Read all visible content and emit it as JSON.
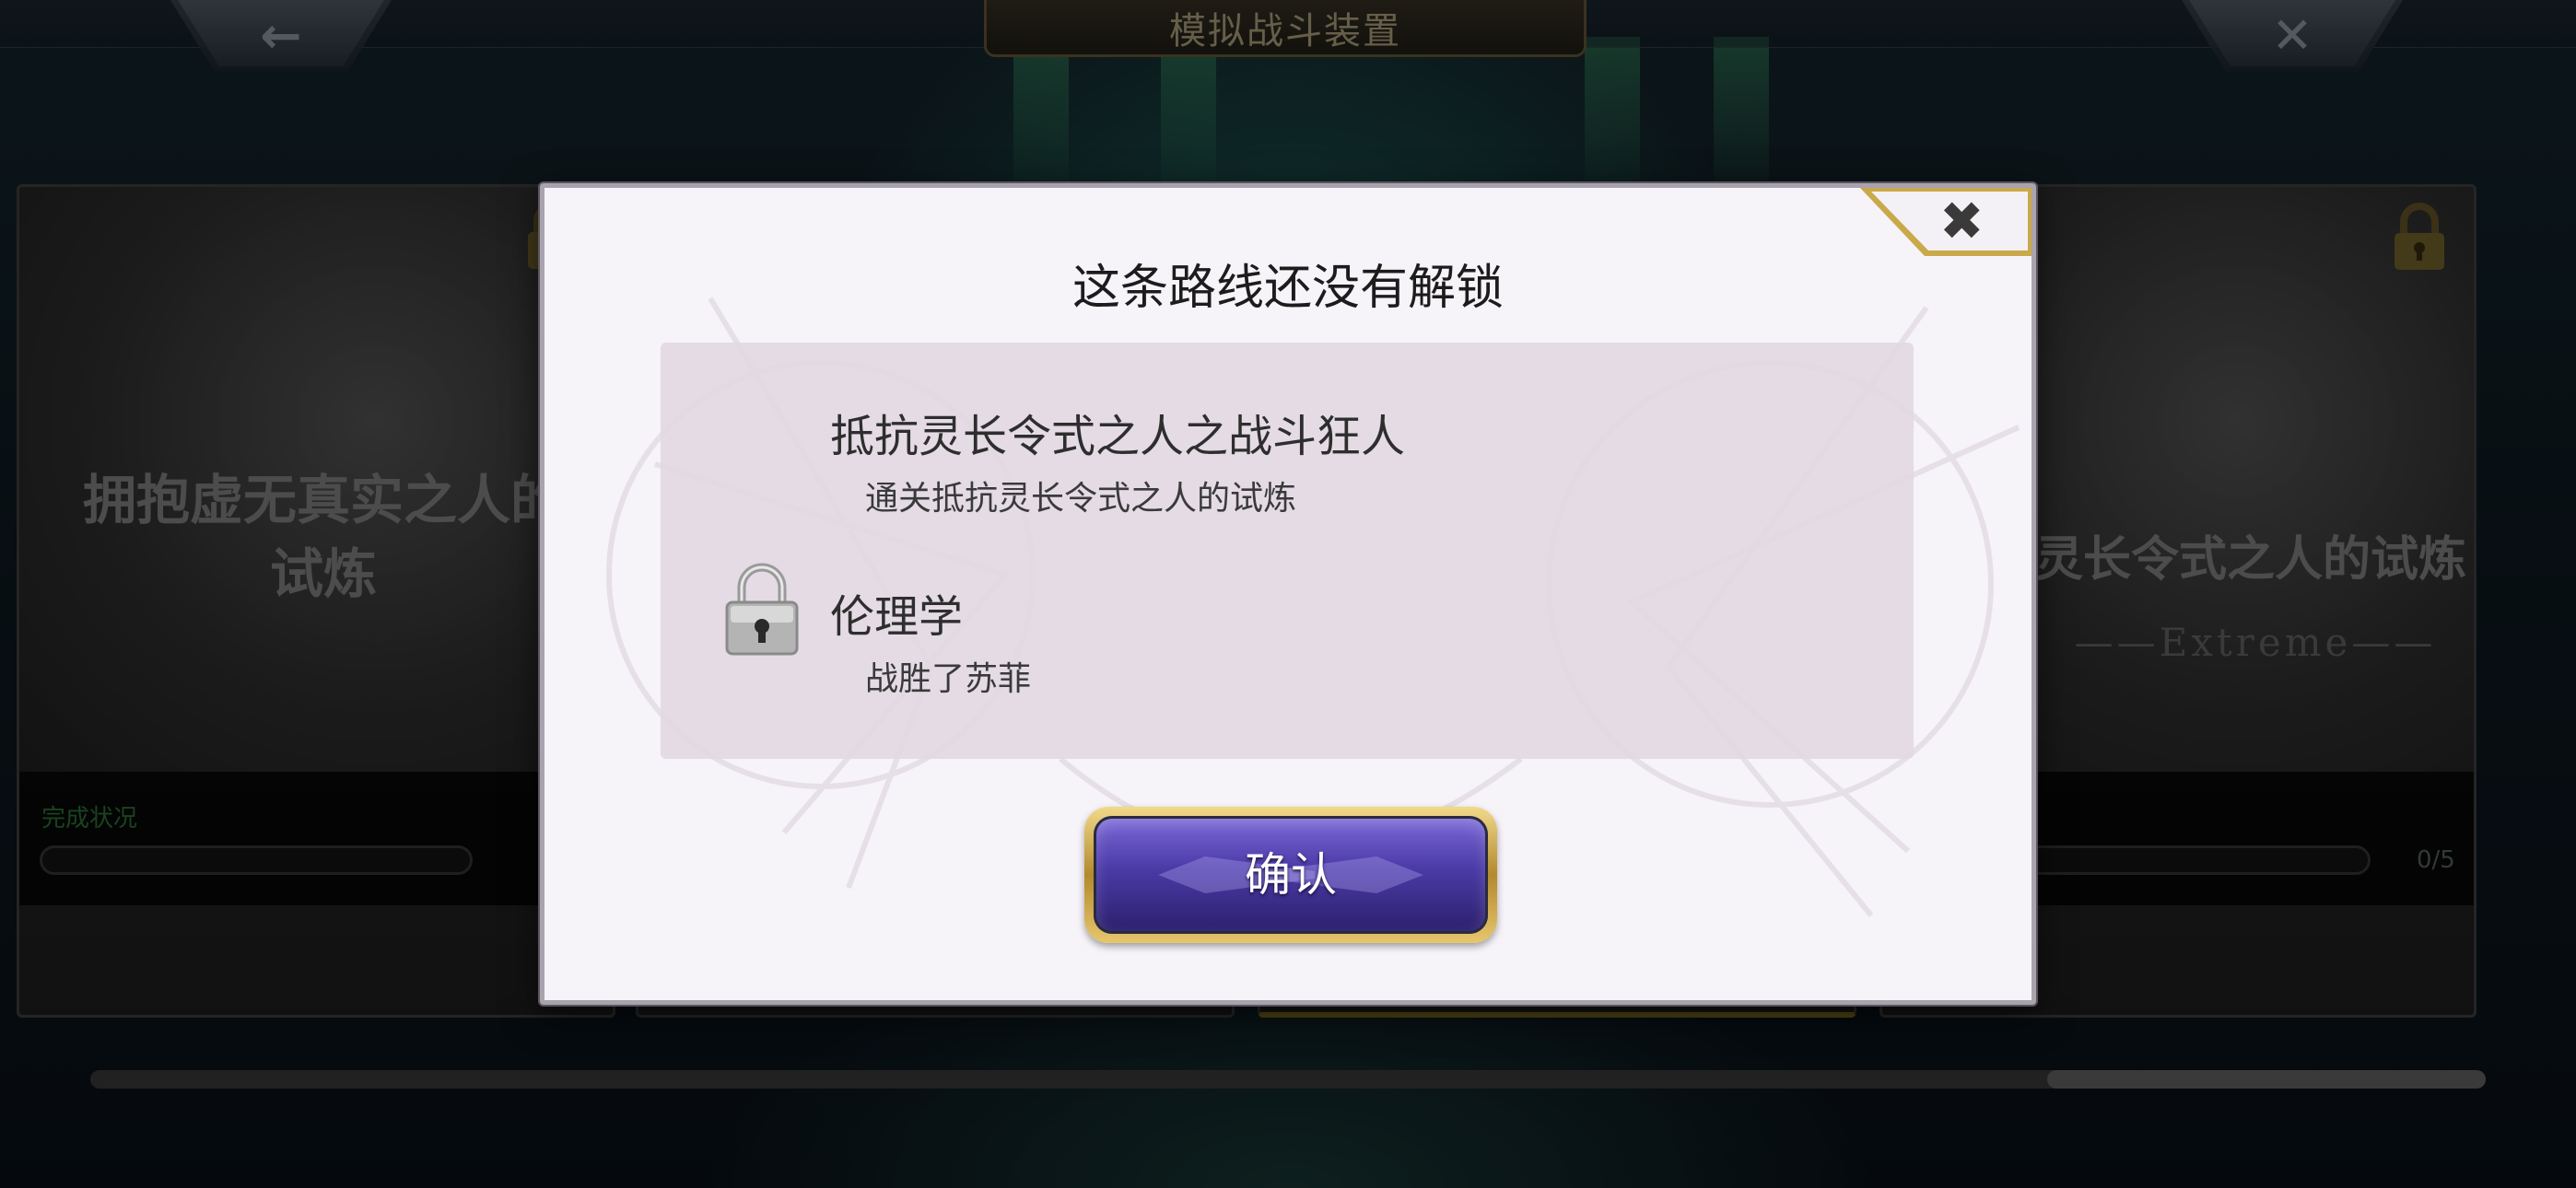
{
  "header": {
    "title": "模拟战斗装置",
    "back_icon": "back-arrow-icon",
    "close_icon": "close-icon"
  },
  "background_cards": [
    {
      "title_line1": "拥抱虚无真实之人的",
      "title_line2": "试炼",
      "progress_label": "完成状况"
    },
    {
      "title_line1": "灵长令式之人的试炼",
      "subtitle": "Extreme",
      "count": "0/5"
    }
  ],
  "modal": {
    "title": "这条路线还没有解锁",
    "close_icon": "close-icon",
    "requirements": [
      {
        "name": "抵抗灵长令式之人之战斗狂人",
        "desc": "通关抵抗灵长令式之人的试炼"
      },
      {
        "name": "伦理学",
        "desc": "战胜了苏菲"
      }
    ],
    "lock_icon": "lock-icon",
    "confirm_label": "确认"
  },
  "colors": {
    "modal_bg": "#f6f3f9",
    "requirement_box": "#e2d8e2",
    "button_purple": "#4a3aa6",
    "button_gold": "#d8b660"
  }
}
